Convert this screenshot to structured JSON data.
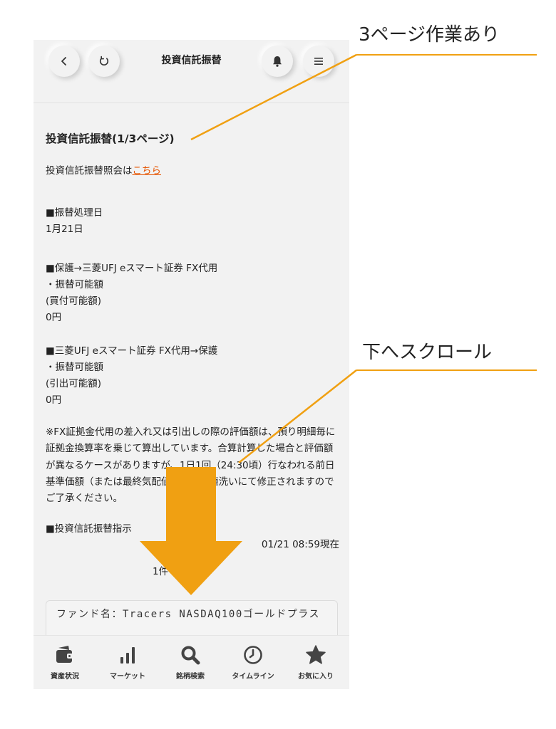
{
  "header": {
    "title": "投資信託振替",
    "back_icon": "chevron-left-icon",
    "refresh_icon": "refresh-icon",
    "bell_icon": "bell-icon",
    "menu_icon": "hamburger-menu-icon"
  },
  "content": {
    "section_title": "投資信託振替(1/3ページ)",
    "inquiry_prefix": "投資信託振替照会は",
    "inquiry_link": "こちら",
    "date_heading": "■振替処理日",
    "date_value": "1月21日",
    "to_fx_heading": "■保護→三菱UFJ eスマート証券 FX代用",
    "to_fx_label1": "・振替可能額",
    "to_fx_label2": "(買付可能額)",
    "to_fx_value": "0円",
    "from_fx_heading": "■三菱UFJ eスマート証券 FX代用→保護",
    "from_fx_label1": "・振替可能額",
    "from_fx_label2": "(引出可能額)",
    "from_fx_value": "0円",
    "notice": "※FX証拠金代用の差入れ又は引出しの際の評価額は、預り明細毎に証拠金換算率を乗じて算出しています。合算計算した場合と評価額が異なるケースがありますが、1日1回（24:30頃）行なわれる前日基準価額（または最終気配値）による値洗いにて修正されますのでご了承ください。",
    "instruction_heading": "■投資信託振替指示",
    "timestamp": "01/21 08:59現在",
    "count": "1件",
    "fund_name": "ファンド名：Tracers NASDAQ100ゴールドプラス"
  },
  "bottom_nav": [
    {
      "label": "資産状況",
      "icon": "wallet-icon"
    },
    {
      "label": "マーケット",
      "icon": "bar-chart-icon"
    },
    {
      "label": "銘柄検索",
      "icon": "search-icon"
    },
    {
      "label": "タイムライン",
      "icon": "clock-icon"
    },
    {
      "label": "お気に入り",
      "icon": "star-icon"
    }
  ],
  "annotations": {
    "pages_note": "3ページ作業あり",
    "scroll_note": "下へスクロール",
    "accent_color": "#f0a012",
    "arrow_icon": "down-arrow-icon"
  },
  "colors": {
    "link": "#e65400",
    "background": "#f2f2f2",
    "icon": "#444444"
  }
}
